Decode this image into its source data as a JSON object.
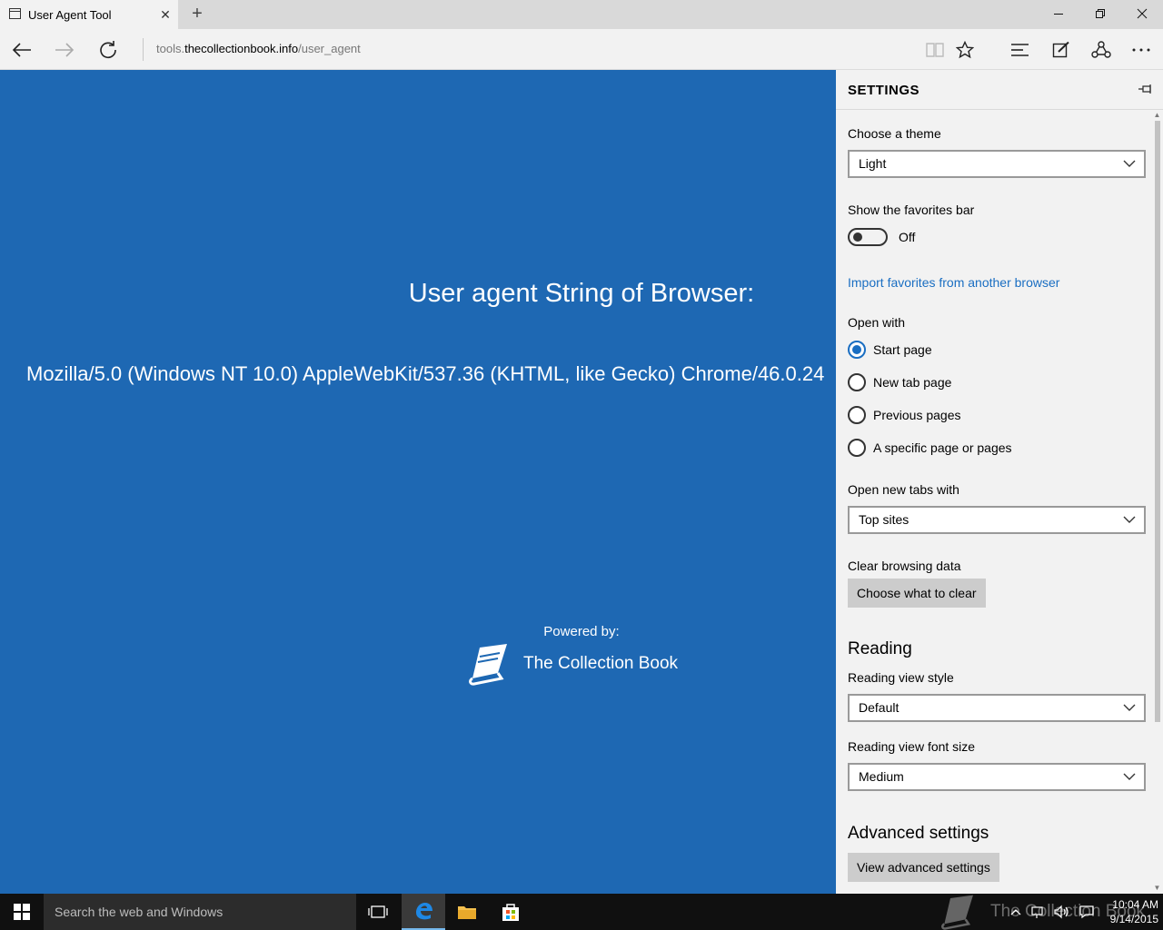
{
  "browser": {
    "tab_title": "User Agent Tool",
    "address_prefix": "tools.",
    "address_host": "thecollectionbook.info",
    "address_path": "/user_agent"
  },
  "page": {
    "heading": "User agent String of Browser:",
    "ua_string": "Mozilla/5.0 (Windows NT 10.0) AppleWebKit/537.36 (KHTML, like Gecko) Chrome/46.0.24",
    "powered_by": "Powered by:",
    "brand_name": "The Collection Book",
    "background_color": "#1e68b3"
  },
  "settings": {
    "title": "SETTINGS",
    "theme_label": "Choose a theme",
    "theme_value": "Light",
    "favorites_bar_label": "Show the favorites bar",
    "favorites_bar_state": "Off",
    "import_link": "Import favorites from another browser",
    "open_with_label": "Open with",
    "open_with_options": [
      "Start page",
      "New tab page",
      "Previous pages",
      "A specific page or pages"
    ],
    "open_with_selected": "Start page",
    "new_tabs_label": "Open new tabs with",
    "new_tabs_value": "Top sites",
    "clear_label": "Clear browsing data",
    "clear_button": "Choose what to clear",
    "reading_heading": "Reading",
    "reading_style_label": "Reading view style",
    "reading_style_value": "Default",
    "reading_font_label": "Reading view font size",
    "reading_font_value": "Medium",
    "advanced_heading": "Advanced settings",
    "advanced_button": "View advanced settings",
    "accent_color": "#1a6ec2"
  },
  "taskbar": {
    "search_placeholder": "Search the web and Windows",
    "watermark_text": "The Collection Book",
    "time": "10:04 AM",
    "date": "9/14/2015"
  }
}
